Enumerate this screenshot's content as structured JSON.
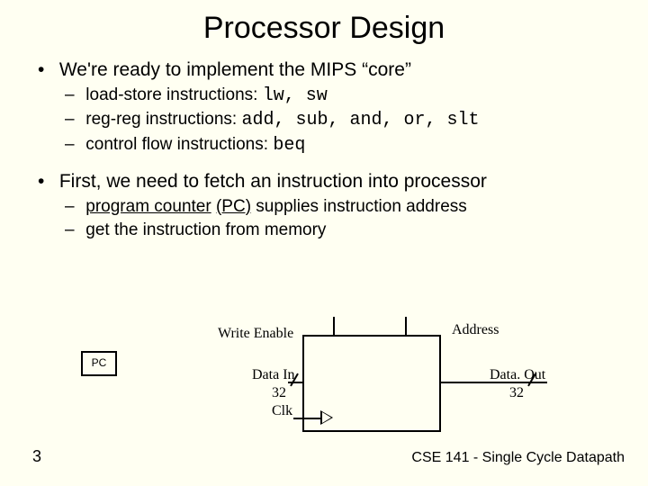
{
  "slide": {
    "title": "Processor Design",
    "bullets": [
      {
        "text": "We're ready to implement the MIPS  “core”",
        "sub": [
          {
            "prefix": "load-store instructions:  ",
            "code": "lw, sw"
          },
          {
            "prefix": "reg-reg instructions:  ",
            "code": "add, sub, and, or, slt"
          },
          {
            "prefix": "control flow instructions:  ",
            "code": "beq"
          }
        ]
      },
      {
        "text": "First, we need to fetch an instruction into processor",
        "sub": [
          {
            "underline": "program counter",
            "paren": "(PC)",
            "rest": " supplies instruction address"
          },
          {
            "plain": "get the instruction from memory"
          }
        ]
      }
    ],
    "diagram": {
      "pc": "PC",
      "write_enable": "Write Enable",
      "address": "Address",
      "data_in": "Data In",
      "data_out": "Data. Out",
      "bus_width_left": "32",
      "bus_width_right": "32",
      "clk": "Clk"
    },
    "footer": {
      "page": "3",
      "course": "CSE 141 - Single Cycle Datapath"
    }
  }
}
